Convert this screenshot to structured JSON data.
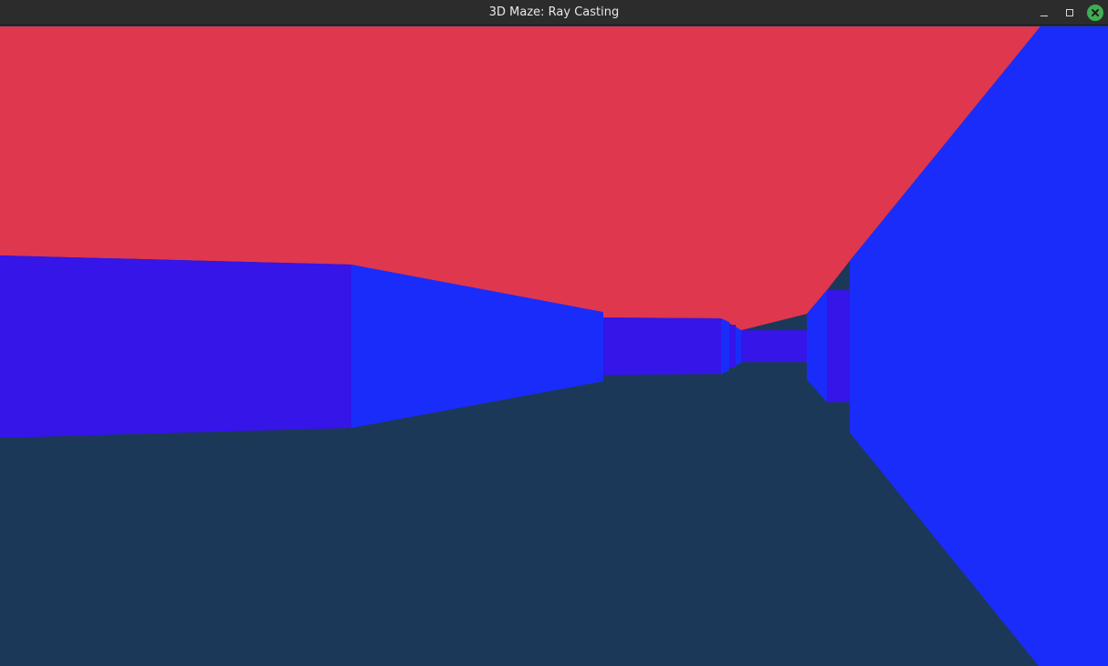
{
  "window": {
    "title": "3D Maze: Ray Casting",
    "controls": [
      "minimize",
      "maximize",
      "close"
    ]
  },
  "scene": {
    "colors": {
      "ceiling": "#df374d",
      "floor": "#1c3858",
      "wall_dark": "#3515e8",
      "wall_light": "#1a2cfa",
      "titlebar": "#2c2c2c",
      "close_button": "#3fae53"
    }
  }
}
